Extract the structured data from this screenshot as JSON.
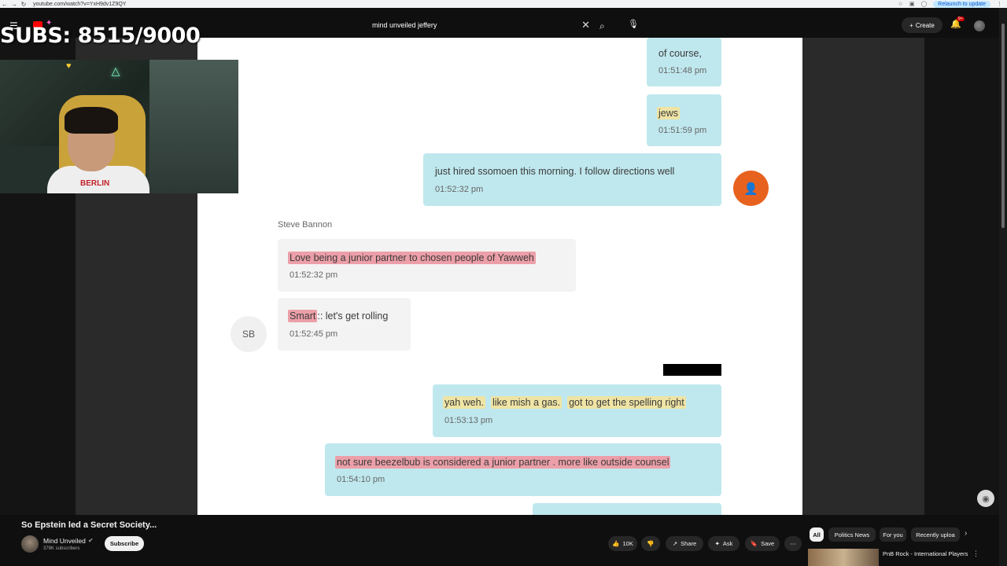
{
  "browser": {
    "url": "youtube.com/watch?v=YxH9dv1Z9QY",
    "relaunch_label": "Relaunch to update"
  },
  "topbar": {
    "search_value": "mind unveiled jeffery",
    "create_label": "Create",
    "notification_count": "9+"
  },
  "overlay": {
    "subs_text": "SUBS: 8515/9000",
    "shirt_text": "BERLIN"
  },
  "chat": {
    "messages": [
      {
        "text": "of course,",
        "time": "01:51:48 pm"
      },
      {
        "text": "jews",
        "time": "01:51:59 pm"
      },
      {
        "text": "just hired ssomoen this morning.   I follow directions well",
        "time": "01:52:32 pm"
      },
      {
        "text": "Love being a junior partner to chosen people of Yawweh",
        "time": "01:52:32 pm"
      },
      {
        "text_hl": "Smart",
        "text_rest": ":: let's get rolling",
        "time": "01:52:45 pm"
      },
      {
        "parts": [
          "yah weh.",
          "like mish a gas.",
          "got to get the spelling right"
        ],
        "time": "01:53:13 pm"
      },
      {
        "text": "not sure beezelbub is considered a junior partner .  more like outside counsel",
        "time": "01:54:10 pm"
      }
    ],
    "sender_name": "Steve Bannon",
    "sender_initials": "SB"
  },
  "video_info": {
    "title": "So Epstein led a Secret Society...",
    "channel_name": "Mind Unveiled",
    "channel_subs": "378K subscribers",
    "subscribe_label": "Subscribe",
    "likes": "10K",
    "share_label": "Share",
    "ask_label": "Ask",
    "save_label": "Save"
  },
  "chips": [
    "All",
    "Politics News",
    "For you",
    "Recently uploa"
  ],
  "recommendation": {
    "title": "PnB Rock - International Players Anthem"
  },
  "colors": {
    "out_bubble": "#bfe8ee",
    "in_bubble": "#f3f3f3",
    "highlight_yellow": "#efe4a4",
    "highlight_red": "#ec9fa8",
    "avatar_orange": "#e8621f"
  }
}
